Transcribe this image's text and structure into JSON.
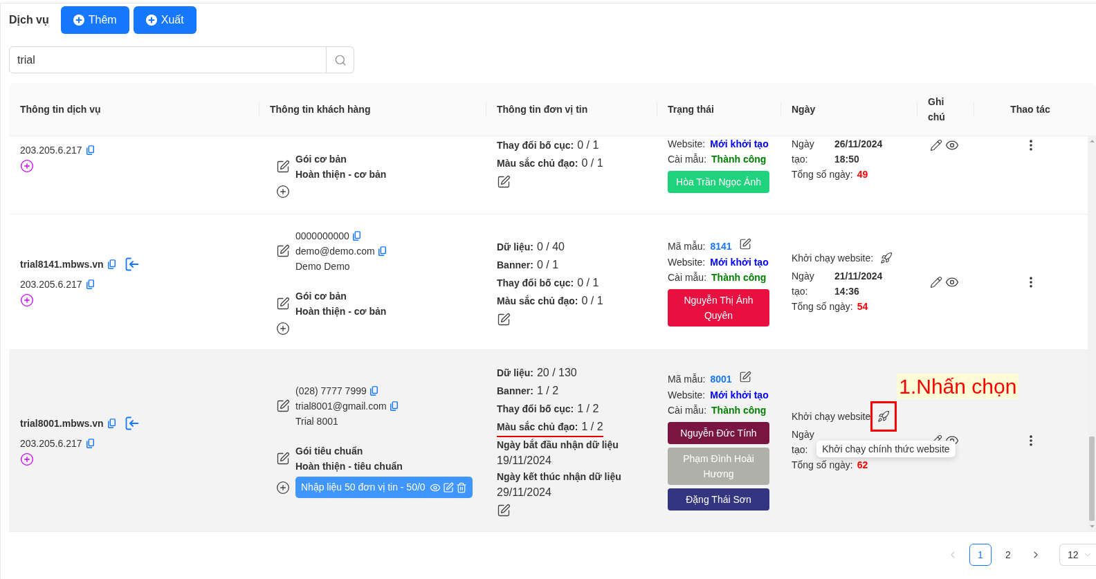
{
  "page": {
    "title": "Dịch vụ"
  },
  "toolbar": {
    "buttons": [
      {
        "label": "Thêm"
      },
      {
        "label": "Xuất"
      }
    ]
  },
  "search": {
    "value": "trial"
  },
  "table": {
    "columns": [
      "Thông tin dịch vụ",
      "Thông tin khách hàng",
      "Thông tin đơn vị tin",
      "Trạng thái",
      "Ngày",
      "Ghi chú",
      "Thao tác"
    ],
    "rows": [
      {
        "clipped": true,
        "hovered": false,
        "service": {
          "ip": "203.205.6.217"
        },
        "customer": {
          "package": [
            "Gói cơ bản",
            "Hoàn thiện - cơ bản"
          ]
        },
        "units": {
          "stats": [
            {
              "label": "Thay đổi bố cục:",
              "value": "0 / 1",
              "underlined": false
            },
            {
              "label": "Màu sắc chủ đạo:",
              "value": "0 / 1",
              "underlined": false
            }
          ]
        },
        "status": {
          "fields": [
            {
              "kind": "website",
              "label": "Website:",
              "value": "Mới khởi tạo"
            },
            {
              "kind": "install",
              "label": "Cài mẫu:",
              "value": "Thành công"
            }
          ],
          "staff": [
            {
              "name": "Hòa Trần Ngọc Ánh",
              "color": "#1fd27c"
            }
          ]
        },
        "dates": {
          "created_label": "Ngày tạo:",
          "created_date": "26/11/2024",
          "created_time": "18:50",
          "total_label": "Tổng số ngày:",
          "total": "49"
        }
      },
      {
        "clipped": false,
        "hovered": false,
        "service": {
          "domain": "trial8141.mbws.vn",
          "ip": "203.205.6.217"
        },
        "customer": {
          "contact": [
            {
              "kind": "phone",
              "text": "0000000000"
            },
            {
              "kind": "email",
              "text": "demo@demo.com"
            },
            {
              "kind": "name",
              "text": "Demo Demo"
            }
          ],
          "package": [
            "Gói cơ bản",
            "Hoàn thiện - cơ bản"
          ]
        },
        "units": {
          "stats": [
            {
              "label": "Dữ liệu:",
              "value": "0 / 40",
              "underlined": false
            },
            {
              "label": "Banner:",
              "value": "0 / 1",
              "underlined": false
            },
            {
              "label": "Thay đổi bố cục:",
              "value": "0 / 1",
              "underlined": false
            },
            {
              "label": "Màu sắc chủ đạo:",
              "value": "0 / 1",
              "underlined": false
            }
          ]
        },
        "status": {
          "fields": [
            {
              "kind": "template",
              "label": "Mã mẫu:",
              "value": "8141"
            },
            {
              "kind": "website",
              "label": "Website:",
              "value": "Mới khởi tạo"
            },
            {
              "kind": "install",
              "label": "Cài mẫu:",
              "value": "Thành công"
            }
          ],
          "staff": [
            {
              "name": "Nguyễn Thị Ánh Quyên",
              "color": "#e8103f"
            }
          ]
        },
        "dates": {
          "launch": {
            "label": "Khởi chạy website:",
            "highlighted": false
          },
          "created_label": "Ngày tạo:",
          "created_date": "21/11/2024",
          "created_time": "14:36",
          "total_label": "Tổng số ngày:",
          "total": "54"
        }
      },
      {
        "clipped": false,
        "hovered": true,
        "service": {
          "domain": "trial8001.mbws.vn",
          "ip": "203.205.6.217"
        },
        "customer": {
          "contact": [
            {
              "kind": "phone",
              "text": "(028) 7777 7999"
            },
            {
              "kind": "email",
              "text": "trial8001@gmail.com"
            },
            {
              "kind": "name",
              "text": "Trial 8001"
            }
          ],
          "package": [
            "Gói tiêu chuẩn",
            "Hoàn thiện - tiêu chuẩn"
          ],
          "tags": [
            {
              "text": "Nhập liệu 50 đơn vị tin - 50/0"
            }
          ]
        },
        "units": {
          "stats": [
            {
              "label": "Dữ liệu:",
              "value": "20 / 130",
              "underlined": false
            },
            {
              "label": "Banner:",
              "value": "1 / 2",
              "underlined": false
            },
            {
              "label": "Thay đổi bố cục:",
              "value": "1 / 2",
              "underlined": false
            },
            {
              "label": "Màu sắc chủ đạo:",
              "value": "1 / 2",
              "underlined": true
            }
          ],
          "periods": [
            {
              "label": "Ngày bắt đầu nhận dữ liệu",
              "value": "19/11/2024"
            },
            {
              "label": "Ngày kết thúc nhận dữ liệu",
              "value": "29/11/2024"
            }
          ]
        },
        "status": {
          "fields": [
            {
              "kind": "template",
              "label": "Mã mẫu:",
              "value": "8001"
            },
            {
              "kind": "website",
              "label": "Website:",
              "value": "Mới khởi tạo"
            },
            {
              "kind": "install",
              "label": "Cài mẫu:",
              "value": "Thành công"
            }
          ],
          "staff": [
            {
              "name": "Nguyễn Đức Tính",
              "color": "#7a1541"
            },
            {
              "name": "Phạm Đình Hoài Hương",
              "color": "#afb0a8"
            },
            {
              "name": "Đặng Thái Sơn",
              "color": "#343580"
            }
          ]
        },
        "dates": {
          "launch": {
            "label": "Khởi chạy website",
            "highlighted": true,
            "callout": "1.Nhấn chọn",
            "tooltip": "Khởi chạy chính thức website"
          },
          "created_label": "Ngày tạo:",
          "total_label": "Tổng số ngày:",
          "total": "62"
        }
      }
    ]
  },
  "pagination": {
    "previous_disabled": true,
    "pages": [
      {
        "label": "1",
        "selected": true
      },
      {
        "label": "2",
        "selected": false
      }
    ],
    "next_disabled": false,
    "page_size": "12"
  }
}
